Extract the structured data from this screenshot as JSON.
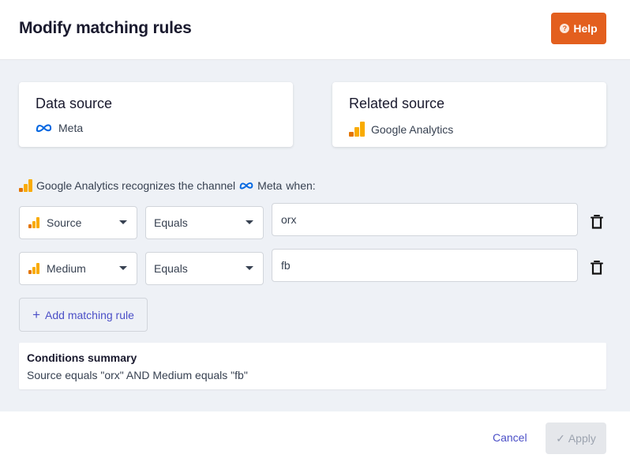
{
  "dialog": {
    "title": "Modify matching rules"
  },
  "help_button": {
    "label": "Help"
  },
  "data_source": {
    "title": "Data source",
    "value": "Meta",
    "icon": "meta-icon"
  },
  "related_source": {
    "title": "Related source",
    "value": "Google Analytics",
    "icon": "google-analytics-icon"
  },
  "recognition": {
    "prefix": "Google Analytics recognizes the channel",
    "channel": "Meta",
    "suffix": "when:"
  },
  "rules": [
    {
      "field": "Source",
      "operator": "Equals",
      "value": "orx"
    },
    {
      "field": "Medium",
      "operator": "Equals",
      "value": "fb"
    }
  ],
  "add_rule_button": {
    "label": "Add matching rule"
  },
  "summary": {
    "title": "Conditions summary",
    "text": "Source equals \"orx\" AND Medium equals \"fb\""
  },
  "footer": {
    "cancel_label": "Cancel",
    "apply_label": "Apply"
  },
  "colors": {
    "accent": "#e35f1e",
    "link": "#4b4fc7",
    "meta_blue": "#0668e1",
    "ga_orange": "#f9ab00",
    "ga_dark": "#e37400"
  }
}
